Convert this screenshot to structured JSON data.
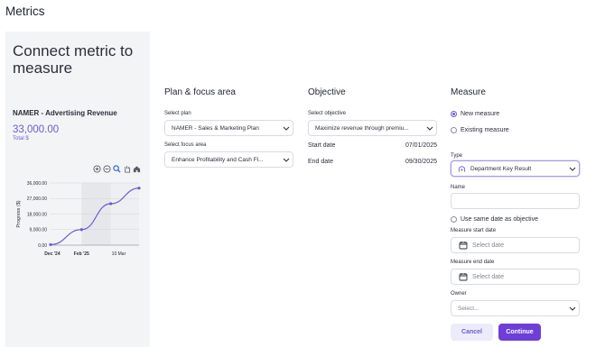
{
  "page": {
    "title": "Metrics"
  },
  "left_panel": {
    "title": "Connect metric to measure",
    "metric_name": "NAMER - Advertising Revenue",
    "metric_value": "33,000.00",
    "metric_sub": "Total $",
    "chart_tools": [
      "zoom-in-icon",
      "zoom-out-icon",
      "magnifier-icon",
      "pan-hand-icon",
      "home-icon"
    ]
  },
  "chart_data": {
    "type": "line",
    "ylabel": "Progress ($)",
    "xlabel": "",
    "y_ticks": [
      "36,000.00",
      "27,000.00",
      "18,000.00",
      "9,000.00",
      "0.00"
    ],
    "y_tick_values": [
      36000,
      27000,
      18000,
      9000,
      0
    ],
    "x_ticks": [
      "Dec '24",
      "Feb '25",
      "10 Mar"
    ],
    "ylim": [
      0,
      36000
    ],
    "series": [
      {
        "values": [
          300,
          9000,
          24000,
          33000
        ]
      }
    ],
    "x_positions": [
      0,
      0.35,
      0.68,
      1.0
    ],
    "line_color": "#6d5bd0"
  },
  "plan": {
    "heading": "Plan & focus area",
    "plan_label": "Select plan",
    "plan_value": "NAMER - Sales & Marketing Plan",
    "focus_label": "Select focus area",
    "focus_value": "Enhance Profitability and Cash Fl..."
  },
  "objective": {
    "heading": "Objective",
    "select_label": "Select objective",
    "select_value": "Maximize revenue through premiu...",
    "start_label": "Start date",
    "start_value": "07/01/2025",
    "end_label": "End date",
    "end_value": "09/30/2025"
  },
  "measure": {
    "heading": "Measure",
    "radio_new": "New measure",
    "radio_existing": "Existing measure",
    "type_label": "Type",
    "type_value": "Department Key Result",
    "name_label": "Name",
    "name_value": "",
    "same_date_label": "Use same date as objective",
    "start_label": "Measure start date",
    "start_placeholder": "Select date",
    "end_label": "Measure end date",
    "end_placeholder": "Select date",
    "owner_label": "Owner",
    "owner_placeholder": "Select...",
    "cancel": "Cancel",
    "continue": "Continue"
  },
  "colors": {
    "accent": "#6d5bd0",
    "primary_button": "#6d3fd8",
    "panel_bg": "#f3f4f6"
  }
}
